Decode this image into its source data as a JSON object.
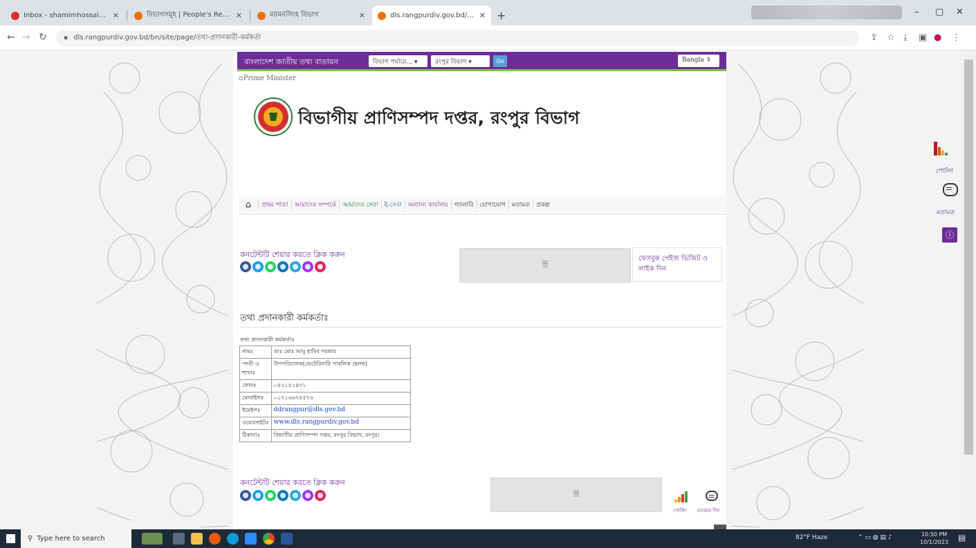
{
  "browser": {
    "tabs": [
      {
        "title": "Inbox - shamimhossainbrm@gm",
        "favicon_color": "#d93025"
      },
      {
        "title": "বিভাগসমূহ | People's Republic o",
        "favicon_color": "#e8710a"
      },
      {
        "title": "ময়মনসিংহ বিভাগ",
        "favicon_color": "#e8710a"
      },
      {
        "title": "dls.rangpurdiv.gov.bd/bn/site/p",
        "favicon_color": "#e8710a"
      }
    ],
    "active_tab_index": 3,
    "url": "dls.rangpurdiv.gov.bd/bn/site/page/তথ্য-প্রদানকারী-কর্মকর্তা",
    "window_controls": {
      "minimize": "–",
      "maximize": "▢",
      "close": "✕"
    }
  },
  "topbar": {
    "portal_name": "বাংলাদেশ জাতীয় তথ্য বাতায়ন",
    "select_level": "বিভাগ পর্যায়ে...",
    "select_division": "রংপুর বিভাগ",
    "go_label": "Go",
    "language": "Bangla"
  },
  "header": {
    "pm_image_alt": "Prime Minister",
    "office_title": "বিভাগীয় প্রাণিসম্পদ দপ্তর, রংপুর বিভাগ"
  },
  "nav": {
    "items": [
      "প্রথম পাতা",
      "আমাদের সম্পর্কে",
      "আমাদের সেবা",
      "ই-সেবা",
      "অন্যান্য কার্যালয়",
      "গ্যালারি",
      "যোগাযোগ",
      "মতামত",
      "প্রকল্প"
    ]
  },
  "share": {
    "label": "কনটেন্টটি শেয়ার করতে ক্লিক করুন",
    "icons": [
      {
        "name": "facebook",
        "color": "#3b5998"
      },
      {
        "name": "twitter",
        "color": "#1da1f2"
      },
      {
        "name": "whatsapp",
        "color": "#25d366"
      },
      {
        "name": "linkedin",
        "color": "#0077b5"
      },
      {
        "name": "telegram",
        "color": "#2ca5e0"
      },
      {
        "name": "messenger",
        "color": "#a033ff"
      },
      {
        "name": "email",
        "color": "#e0245e"
      }
    ]
  },
  "facebook_box": {
    "text": "ফেসবুক পেইজ ভিজিট ও লাইক দিন"
  },
  "content": {
    "section_title": "তথ্য প্রদানকারী কর্মকর্তাঃ",
    "caption": "তথ্য প্রদানকারী কর্মকর্তাঃ",
    "rows": [
      {
        "key": "নামঃ",
        "value": "ডাঃ মোঃ আবু হাবিব সরকার"
      },
      {
        "key": "পদবী ও শাখাঃ",
        "value": "উপপরিচালক(ভেটেরিনারি পাবলিক হেলথ)"
      },
      {
        "key": "ফোনঃ",
        "value": "০৫২১৫১৪৩১"
      },
      {
        "key": "মোবাইলঃ",
        "value": "০১৭১৬৬৭৪৫৭৬"
      },
      {
        "key": "ইমেইলঃ",
        "value": "ddrangpur@dls.gov.bd"
      },
      {
        "key": "ওয়েবসাইটঃ",
        "value": "www.dls.rangpurdiv.gov.bd"
      },
      {
        "key": "ঠিকানাঃ",
        "value": "বিভাগীয় প্রাণিসম্পদ দপ্তর, রংপুর বিভাগ, রংপুর।"
      }
    ]
  },
  "footer_widgets": {
    "poll_label": "পোলিং",
    "feedback_label": "মতামত দিন"
  },
  "side_widgets": {
    "poll_label": "পোলিং",
    "feedback_label": "মতামত"
  },
  "taskbar": {
    "search_placeholder": "Type here to search",
    "weather": "82°F  Haze",
    "time": "10:50 PM",
    "date": "10/1/2023"
  }
}
